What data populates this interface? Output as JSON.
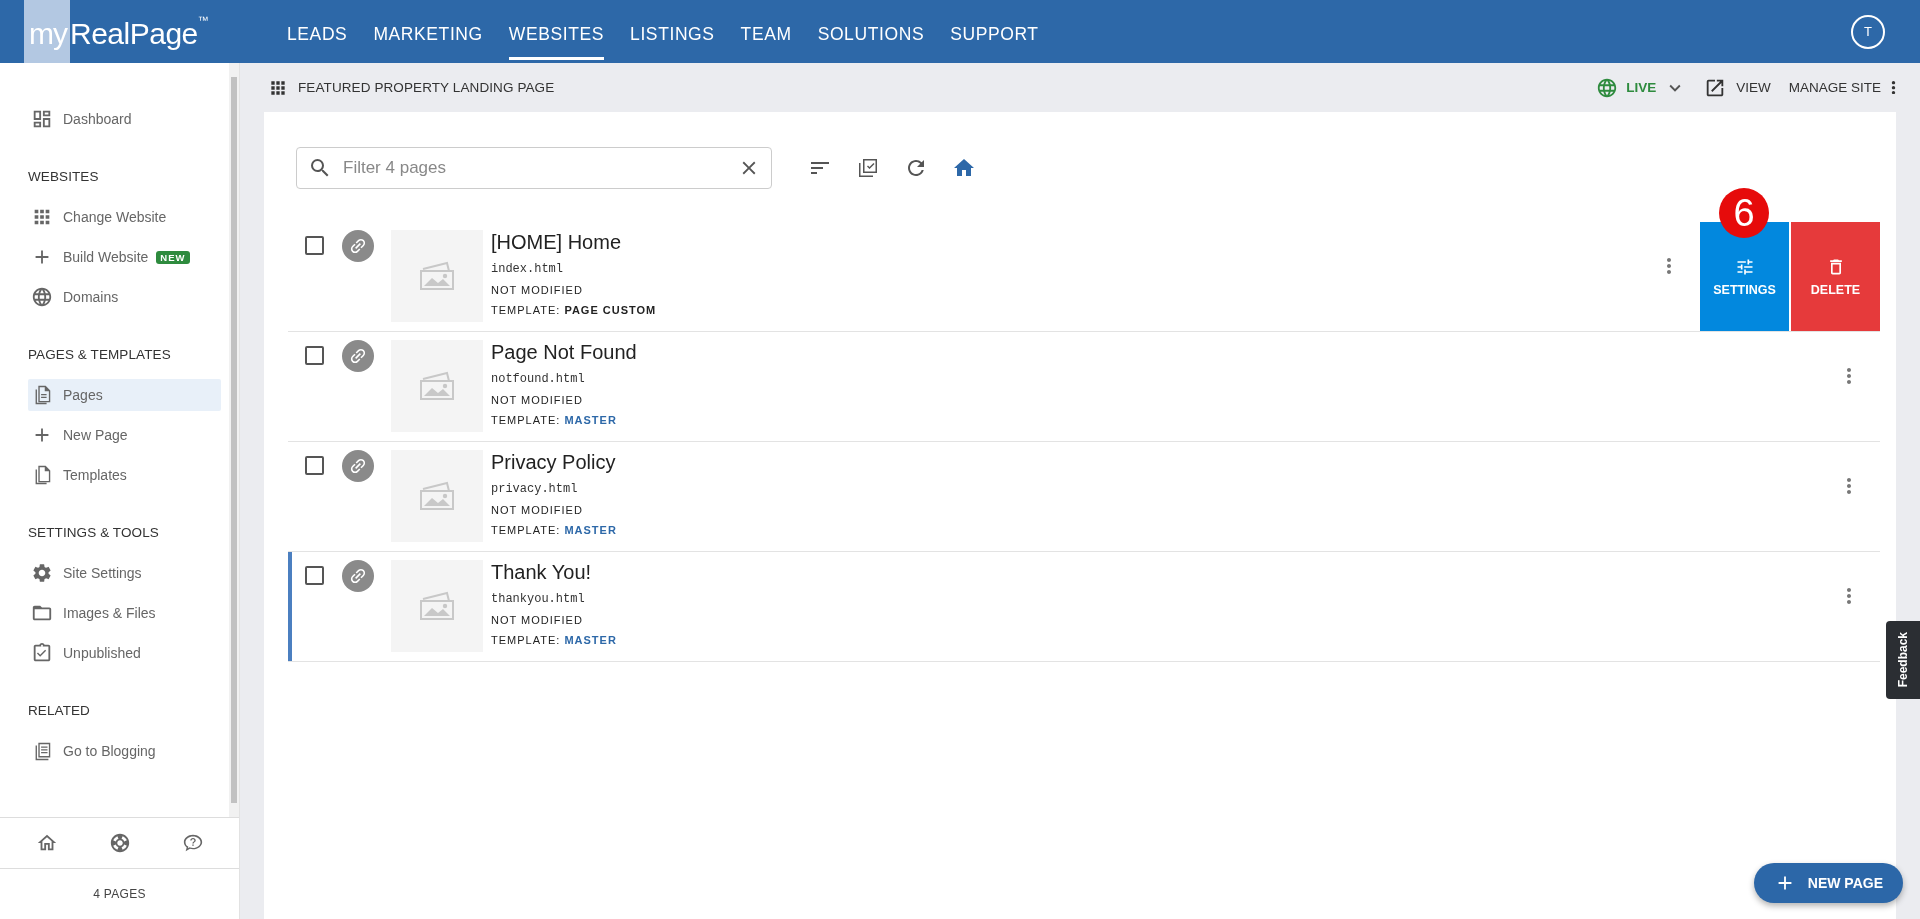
{
  "header": {
    "logo": {
      "prefix": "my",
      "name": "RealPage",
      "mark": "™"
    },
    "nav": [
      {
        "label": "LEADS",
        "selected": false
      },
      {
        "label": "MARKETING",
        "selected": false
      },
      {
        "label": "WEBSITES",
        "selected": true
      },
      {
        "label": "LISTINGS",
        "selected": false
      },
      {
        "label": "TEAM",
        "selected": false
      },
      {
        "label": "SOLUTIONS",
        "selected": false
      },
      {
        "label": "SUPPORT",
        "selected": false
      }
    ],
    "avatar": "T"
  },
  "sidebar": {
    "sections": [
      {
        "items": [
          {
            "label": "Dashboard",
            "selected": false
          }
        ]
      },
      {
        "heading": "WEBSITES",
        "items": [
          {
            "label": "Change Website",
            "selected": false
          },
          {
            "label": "Build Website",
            "badge": "NEW",
            "selected": false
          },
          {
            "label": "Domains",
            "selected": false
          }
        ]
      },
      {
        "heading": "PAGES & TEMPLATES",
        "items": [
          {
            "label": "Pages",
            "selected": true
          },
          {
            "label": "New Page",
            "selected": false
          },
          {
            "label": "Templates",
            "selected": false
          }
        ]
      },
      {
        "heading": "SETTINGS & TOOLS",
        "items": [
          {
            "label": "Site Settings",
            "selected": false
          },
          {
            "label": "Images & Files",
            "selected": false
          },
          {
            "label": "Unpublished",
            "selected": false
          }
        ]
      },
      {
        "heading": "RELATED",
        "items": [
          {
            "label": "Go to Blogging",
            "selected": false
          }
        ]
      }
    ],
    "page_count": "4 PAGES"
  },
  "site_bar": {
    "title": "FEATURED PROPERTY LANDING PAGE",
    "status": "LIVE",
    "view": "VIEW",
    "manage": "MANAGE SITE"
  },
  "search": {
    "placeholder": "Filter 4 pages"
  },
  "pages": [
    {
      "title": "[HOME] Home",
      "file": "index.html",
      "status": "NOT MODIFIED",
      "template_label": "TEMPLATE:",
      "template": "PAGE CUSTOM",
      "template_linked": false,
      "checked": false,
      "current": false,
      "actions_revealed": true
    },
    {
      "title": "Page Not Found",
      "file": "notfound.html",
      "status": "NOT MODIFIED",
      "template_label": "TEMPLATE:",
      "template": "MASTER",
      "template_linked": true,
      "checked": false,
      "current": false,
      "actions_revealed": false
    },
    {
      "title": "Privacy Policy",
      "file": "privacy.html",
      "status": "NOT MODIFIED",
      "template_label": "TEMPLATE:",
      "template": "MASTER",
      "template_linked": true,
      "checked": false,
      "current": false,
      "actions_revealed": false
    },
    {
      "title": "Thank You!",
      "file": "thankyou.html",
      "status": "NOT MODIFIED",
      "template_label": "TEMPLATE:",
      "template": "MASTER",
      "template_linked": true,
      "checked": false,
      "current": true,
      "actions_revealed": false
    }
  ],
  "row_actions": {
    "settings": "SETTINGS",
    "delete": "DELETE",
    "callout": "6"
  },
  "feedback": "Feedback",
  "new_page_button": "NEW PAGE"
}
